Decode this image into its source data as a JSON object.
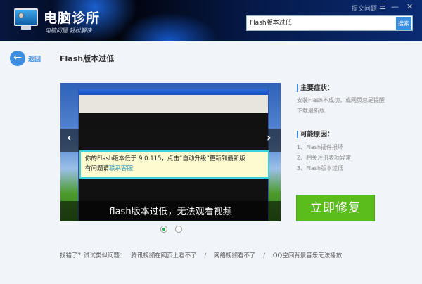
{
  "header": {
    "app_title": "电脑诊所",
    "slogan": "电脑问题 轻松解决",
    "report_link": "提交问题",
    "menu_icon": "☰",
    "minimize_icon": "—",
    "close_icon": "✕",
    "search_value": "Flash版本过低",
    "search_button": "搜索"
  },
  "nav": {
    "back_label": "返回",
    "back_icon": "←",
    "page_title": "Flash版本过低"
  },
  "carousel": {
    "prev_icon": "‹",
    "next_icon": "›",
    "tooltip_line1": "你的Flash版本低于 9.0.115，点击“自动升级”更新到最新版",
    "tooltip_line2_prefix": "有问题请",
    "tooltip_link": "联系客服",
    "caption": "flash版本过低，无法观看视频",
    "slide_count": 2,
    "active_slide": 1
  },
  "symptoms": {
    "title": "主要症状：",
    "text": "安装Flash不成功，或网页总是提醒下载最新版"
  },
  "causes": {
    "title": "可能原因：",
    "items": [
      "1、Flash插件损坏",
      "2、相关注册表项异常",
      "3、Flash版本过低"
    ]
  },
  "fix_button": "立即修复",
  "footer": {
    "prompt": "找错了？试试类似问题：",
    "links": [
      "腾讯视频在网页上看不了",
      "网络视频看不了",
      "QQ空间背景音乐无法播放"
    ],
    "separator": "/"
  }
}
